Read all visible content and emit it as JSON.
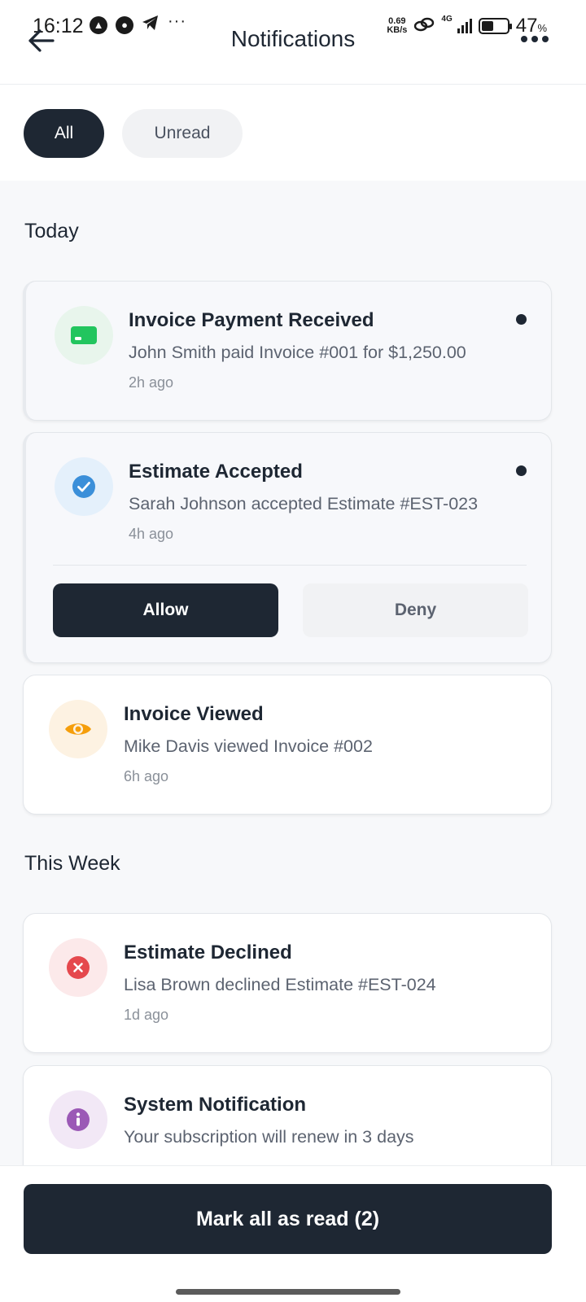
{
  "status_bar": {
    "time": "16:12",
    "net_speed_value": "0.69",
    "net_speed_unit": "KB/s",
    "network_type": "4G",
    "battery_percent": "47",
    "battery_percent_sign": "%",
    "battery_level": 0.47,
    "more": "···"
  },
  "header": {
    "title": "Notifications"
  },
  "filters": {
    "all": "All",
    "unread": "Unread",
    "selected": "All"
  },
  "sections": {
    "today": "Today",
    "this_week": "This Week"
  },
  "notifications": [
    {
      "title": "Invoice Payment Received",
      "message": "John Smith paid Invoice #001 for $1,250.00",
      "time": "2h ago",
      "icon": "credit-card-icon",
      "color": "#22c55e",
      "bg": "#e8f5ec",
      "unread": true
    },
    {
      "title": "Estimate Accepted",
      "message": "Sarah Johnson accepted Estimate #EST-023",
      "time": "4h ago",
      "icon": "check-circle-icon",
      "color": "#3b8fd9",
      "bg": "#e4f0fb",
      "unread": true,
      "actions": {
        "allow": "Allow",
        "deny": "Deny"
      }
    },
    {
      "title": "Invoice Viewed",
      "message": "Mike Davis viewed Invoice #002",
      "time": "6h ago",
      "icon": "eye-icon",
      "color": "#f59e0b",
      "bg": "#fdf2e2",
      "unread": false
    },
    {
      "title": "Estimate Declined",
      "message": "Lisa Brown declined Estimate #EST-024",
      "time": "1d ago",
      "icon": "x-circle-icon",
      "color": "#e5484d",
      "bg": "#fce9ea",
      "unread": false
    },
    {
      "title": "System Notification",
      "message": "Your subscription will renew in 3 days",
      "time": "",
      "icon": "info-icon",
      "color": "#9b59b6",
      "bg": "#f2e8f6",
      "unread": false
    }
  ],
  "footer": {
    "mark_all_label": "Mark all as read (2)"
  },
  "colors": {
    "primary_dark": "#1e2733",
    "page_bg": "#f7f8fa"
  }
}
